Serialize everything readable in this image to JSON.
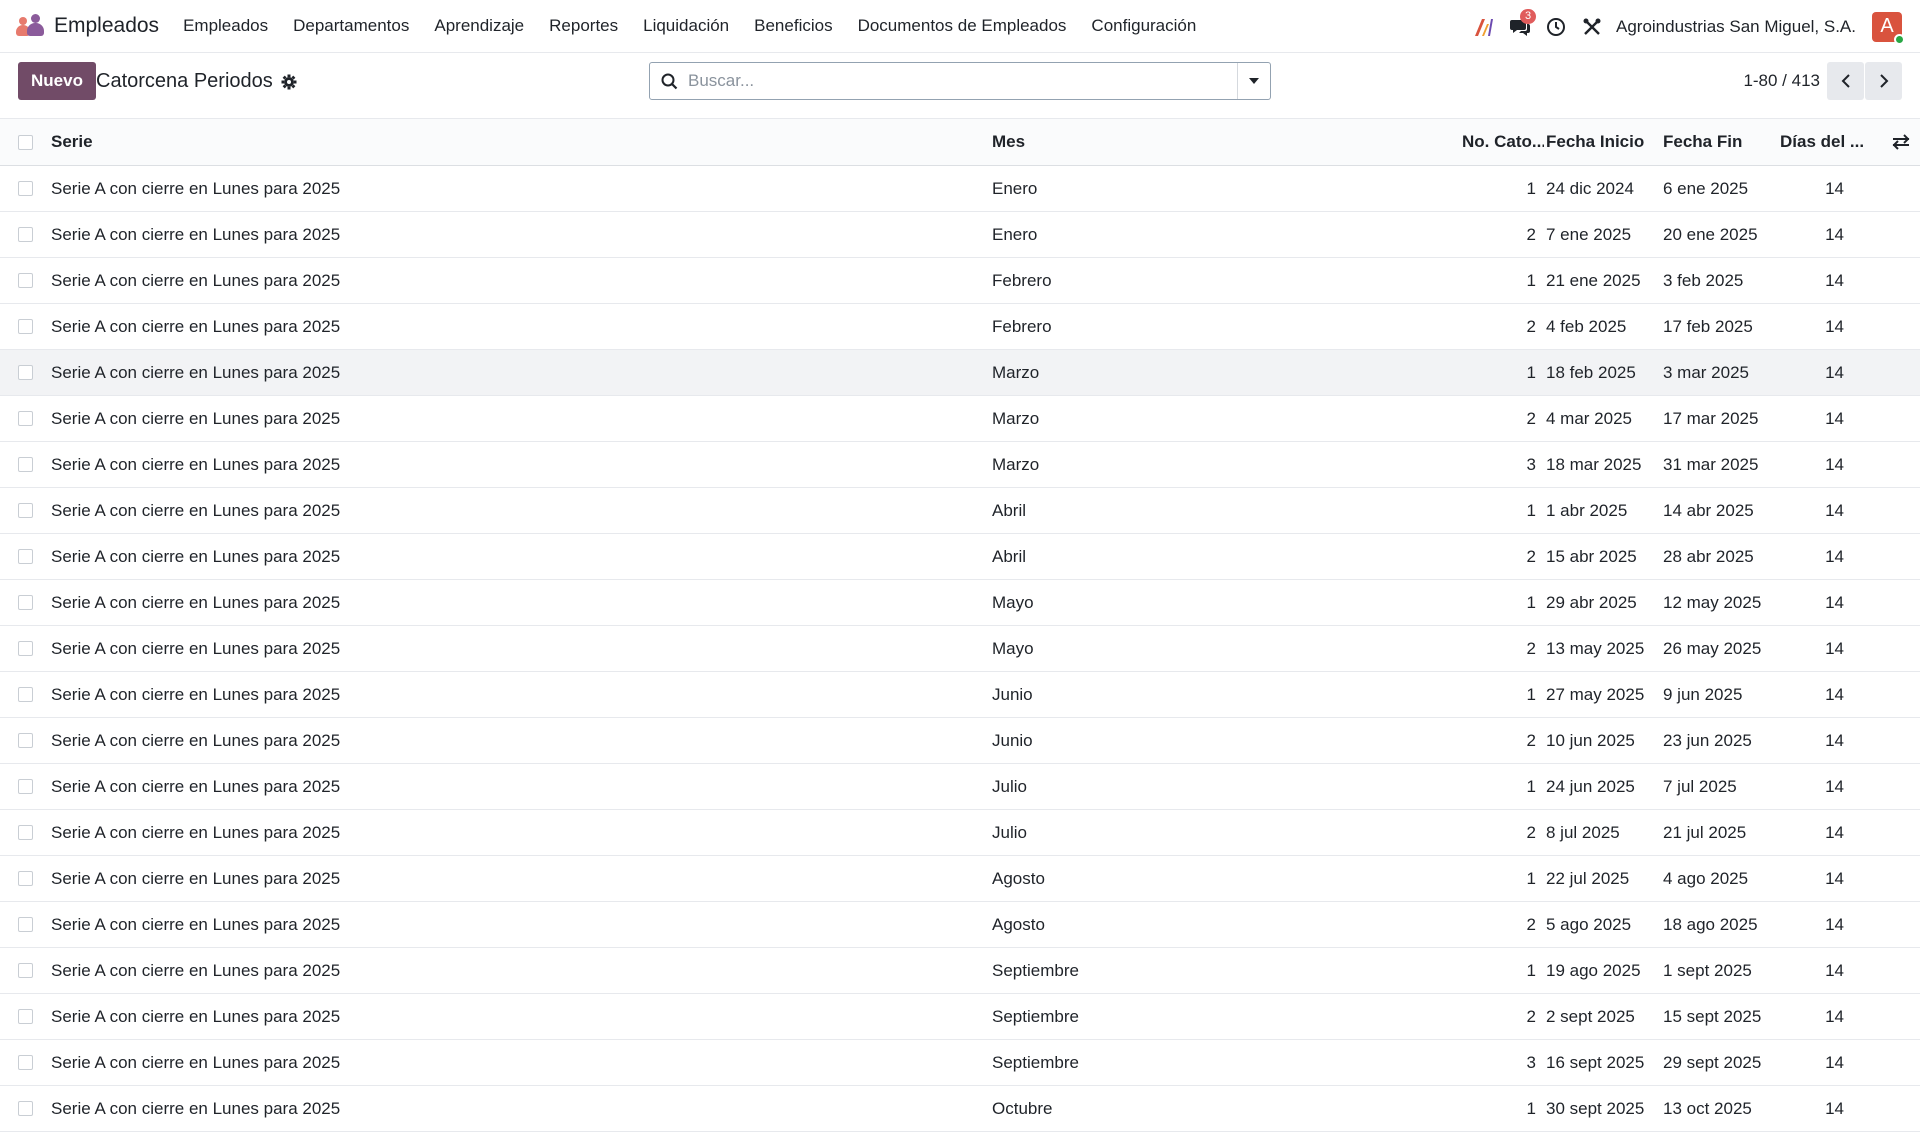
{
  "navbar": {
    "app_name": "Empleados",
    "menu": [
      "Empleados",
      "Departamentos",
      "Aprendizaje",
      "Reportes",
      "Liquidación",
      "Beneficios",
      "Documentos de Empleados",
      "Configuración"
    ],
    "messages_badge": "3",
    "company": "Agroindustrias San Miguel, S.A.",
    "avatar_letter": "A"
  },
  "control": {
    "new_button": "Nuevo",
    "breadcrumb": "Catorcena Periodos",
    "search_placeholder": "Buscar...",
    "pager": "1-80 / 413"
  },
  "table": {
    "headers": {
      "serie": "Serie",
      "mes": "Mes",
      "num": "No. Cato...",
      "inicio": "Fecha Inicio",
      "fin": "Fecha Fin",
      "dias": "Días del ..."
    },
    "rows": [
      {
        "serie": "Serie A con cierre en Lunes para 2025",
        "mes": "Enero",
        "num": "1",
        "inicio": "24 dic 2024",
        "fin": "6 ene 2025",
        "dias": "14"
      },
      {
        "serie": "Serie A con cierre en Lunes para 2025",
        "mes": "Enero",
        "num": "2",
        "inicio": "7 ene 2025",
        "fin": "20 ene 2025",
        "dias": "14"
      },
      {
        "serie": "Serie A con cierre en Lunes para 2025",
        "mes": "Febrero",
        "num": "1",
        "inicio": "21 ene 2025",
        "fin": "3 feb 2025",
        "dias": "14"
      },
      {
        "serie": "Serie A con cierre en Lunes para 2025",
        "mes": "Febrero",
        "num": "2",
        "inicio": "4 feb 2025",
        "fin": "17 feb 2025",
        "dias": "14"
      },
      {
        "serie": "Serie A con cierre en Lunes para 2025",
        "mes": "Marzo",
        "num": "1",
        "inicio": "18 feb 2025",
        "fin": "3 mar 2025",
        "dias": "14"
      },
      {
        "serie": "Serie A con cierre en Lunes para 2025",
        "mes": "Marzo",
        "num": "2",
        "inicio": "4 mar 2025",
        "fin": "17 mar 2025",
        "dias": "14"
      },
      {
        "serie": "Serie A con cierre en Lunes para 2025",
        "mes": "Marzo",
        "num": "3",
        "inicio": "18 mar 2025",
        "fin": "31 mar 2025",
        "dias": "14"
      },
      {
        "serie": "Serie A con cierre en Lunes para 2025",
        "mes": "Abril",
        "num": "1",
        "inicio": "1 abr 2025",
        "fin": "14 abr 2025",
        "dias": "14"
      },
      {
        "serie": "Serie A con cierre en Lunes para 2025",
        "mes": "Abril",
        "num": "2",
        "inicio": "15 abr 2025",
        "fin": "28 abr 2025",
        "dias": "14"
      },
      {
        "serie": "Serie A con cierre en Lunes para 2025",
        "mes": "Mayo",
        "num": "1",
        "inicio": "29 abr 2025",
        "fin": "12 may 2025",
        "dias": "14"
      },
      {
        "serie": "Serie A con cierre en Lunes para 2025",
        "mes": "Mayo",
        "num": "2",
        "inicio": "13 may 2025",
        "fin": "26 may 2025",
        "dias": "14"
      },
      {
        "serie": "Serie A con cierre en Lunes para 2025",
        "mes": "Junio",
        "num": "1",
        "inicio": "27 may 2025",
        "fin": "9 jun 2025",
        "dias": "14"
      },
      {
        "serie": "Serie A con cierre en Lunes para 2025",
        "mes": "Junio",
        "num": "2",
        "inicio": "10 jun 2025",
        "fin": "23 jun 2025",
        "dias": "14"
      },
      {
        "serie": "Serie A con cierre en Lunes para 2025",
        "mes": "Julio",
        "num": "1",
        "inicio": "24 jun 2025",
        "fin": "7 jul 2025",
        "dias": "14"
      },
      {
        "serie": "Serie A con cierre en Lunes para 2025",
        "mes": "Julio",
        "num": "2",
        "inicio": "8 jul 2025",
        "fin": "21 jul 2025",
        "dias": "14"
      },
      {
        "serie": "Serie A con cierre en Lunes para 2025",
        "mes": "Agosto",
        "num": "1",
        "inicio": "22 jul 2025",
        "fin": "4 ago 2025",
        "dias": "14"
      },
      {
        "serie": "Serie A con cierre en Lunes para 2025",
        "mes": "Agosto",
        "num": "2",
        "inicio": "5 ago 2025",
        "fin": "18 ago 2025",
        "dias": "14"
      },
      {
        "serie": "Serie A con cierre en Lunes para 2025",
        "mes": "Septiembre",
        "num": "1",
        "inicio": "19 ago 2025",
        "fin": "1 sept 2025",
        "dias": "14"
      },
      {
        "serie": "Serie A con cierre en Lunes para 2025",
        "mes": "Septiembre",
        "num": "2",
        "inicio": "2 sept 2025",
        "fin": "15 sept 2025",
        "dias": "14"
      },
      {
        "serie": "Serie A con cierre en Lunes para 2025",
        "mes": "Septiembre",
        "num": "3",
        "inicio": "16 sept 2025",
        "fin": "29 sept 2025",
        "dias": "14"
      },
      {
        "serie": "Serie A con cierre en Lunes para 2025",
        "mes": "Octubre",
        "num": "1",
        "inicio": "30 sept 2025",
        "fin": "13 oct 2025",
        "dias": "14"
      }
    ]
  },
  "colors": {
    "primary": "#714b67",
    "badge": "#e05c5c",
    "avatar": "#d9533e"
  }
}
